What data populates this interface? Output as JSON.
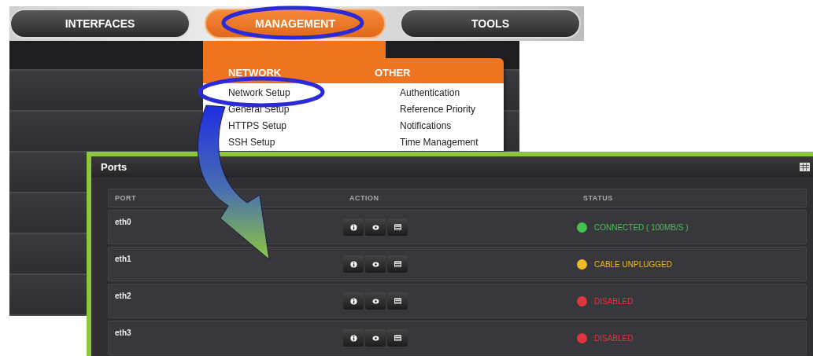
{
  "nav_tabs": [
    {
      "label": "INTERFACES",
      "selected": false
    },
    {
      "label": "MANAGEMENT",
      "selected": true
    },
    {
      "label": "TOOLS",
      "selected": false
    }
  ],
  "menu": {
    "columns": [
      {
        "heading": "NETWORK",
        "items": [
          "Network Setup",
          "General Setup",
          "HTTPS Setup",
          "SSH Setup"
        ]
      },
      {
        "heading": "OTHER",
        "items": [
          "Authentication",
          "Reference Priority",
          "Notifications",
          "Time Management"
        ]
      }
    ]
  },
  "ports_panel": {
    "title": "Ports",
    "columns": [
      "PORT",
      "ACTION",
      "STATUS"
    ],
    "rows": [
      {
        "port": "eth0",
        "status": "CONNECTED ( 100MB/S )",
        "color": "#44c24f"
      },
      {
        "port": "eth1",
        "status": "CABLE UNPLUGGED",
        "color": "#f0b92a"
      },
      {
        "port": "eth2",
        "status": "DISABLED",
        "color": "#e0353f"
      },
      {
        "port": "eth3",
        "status": "DISABLED",
        "color": "#e0353f"
      }
    ]
  }
}
